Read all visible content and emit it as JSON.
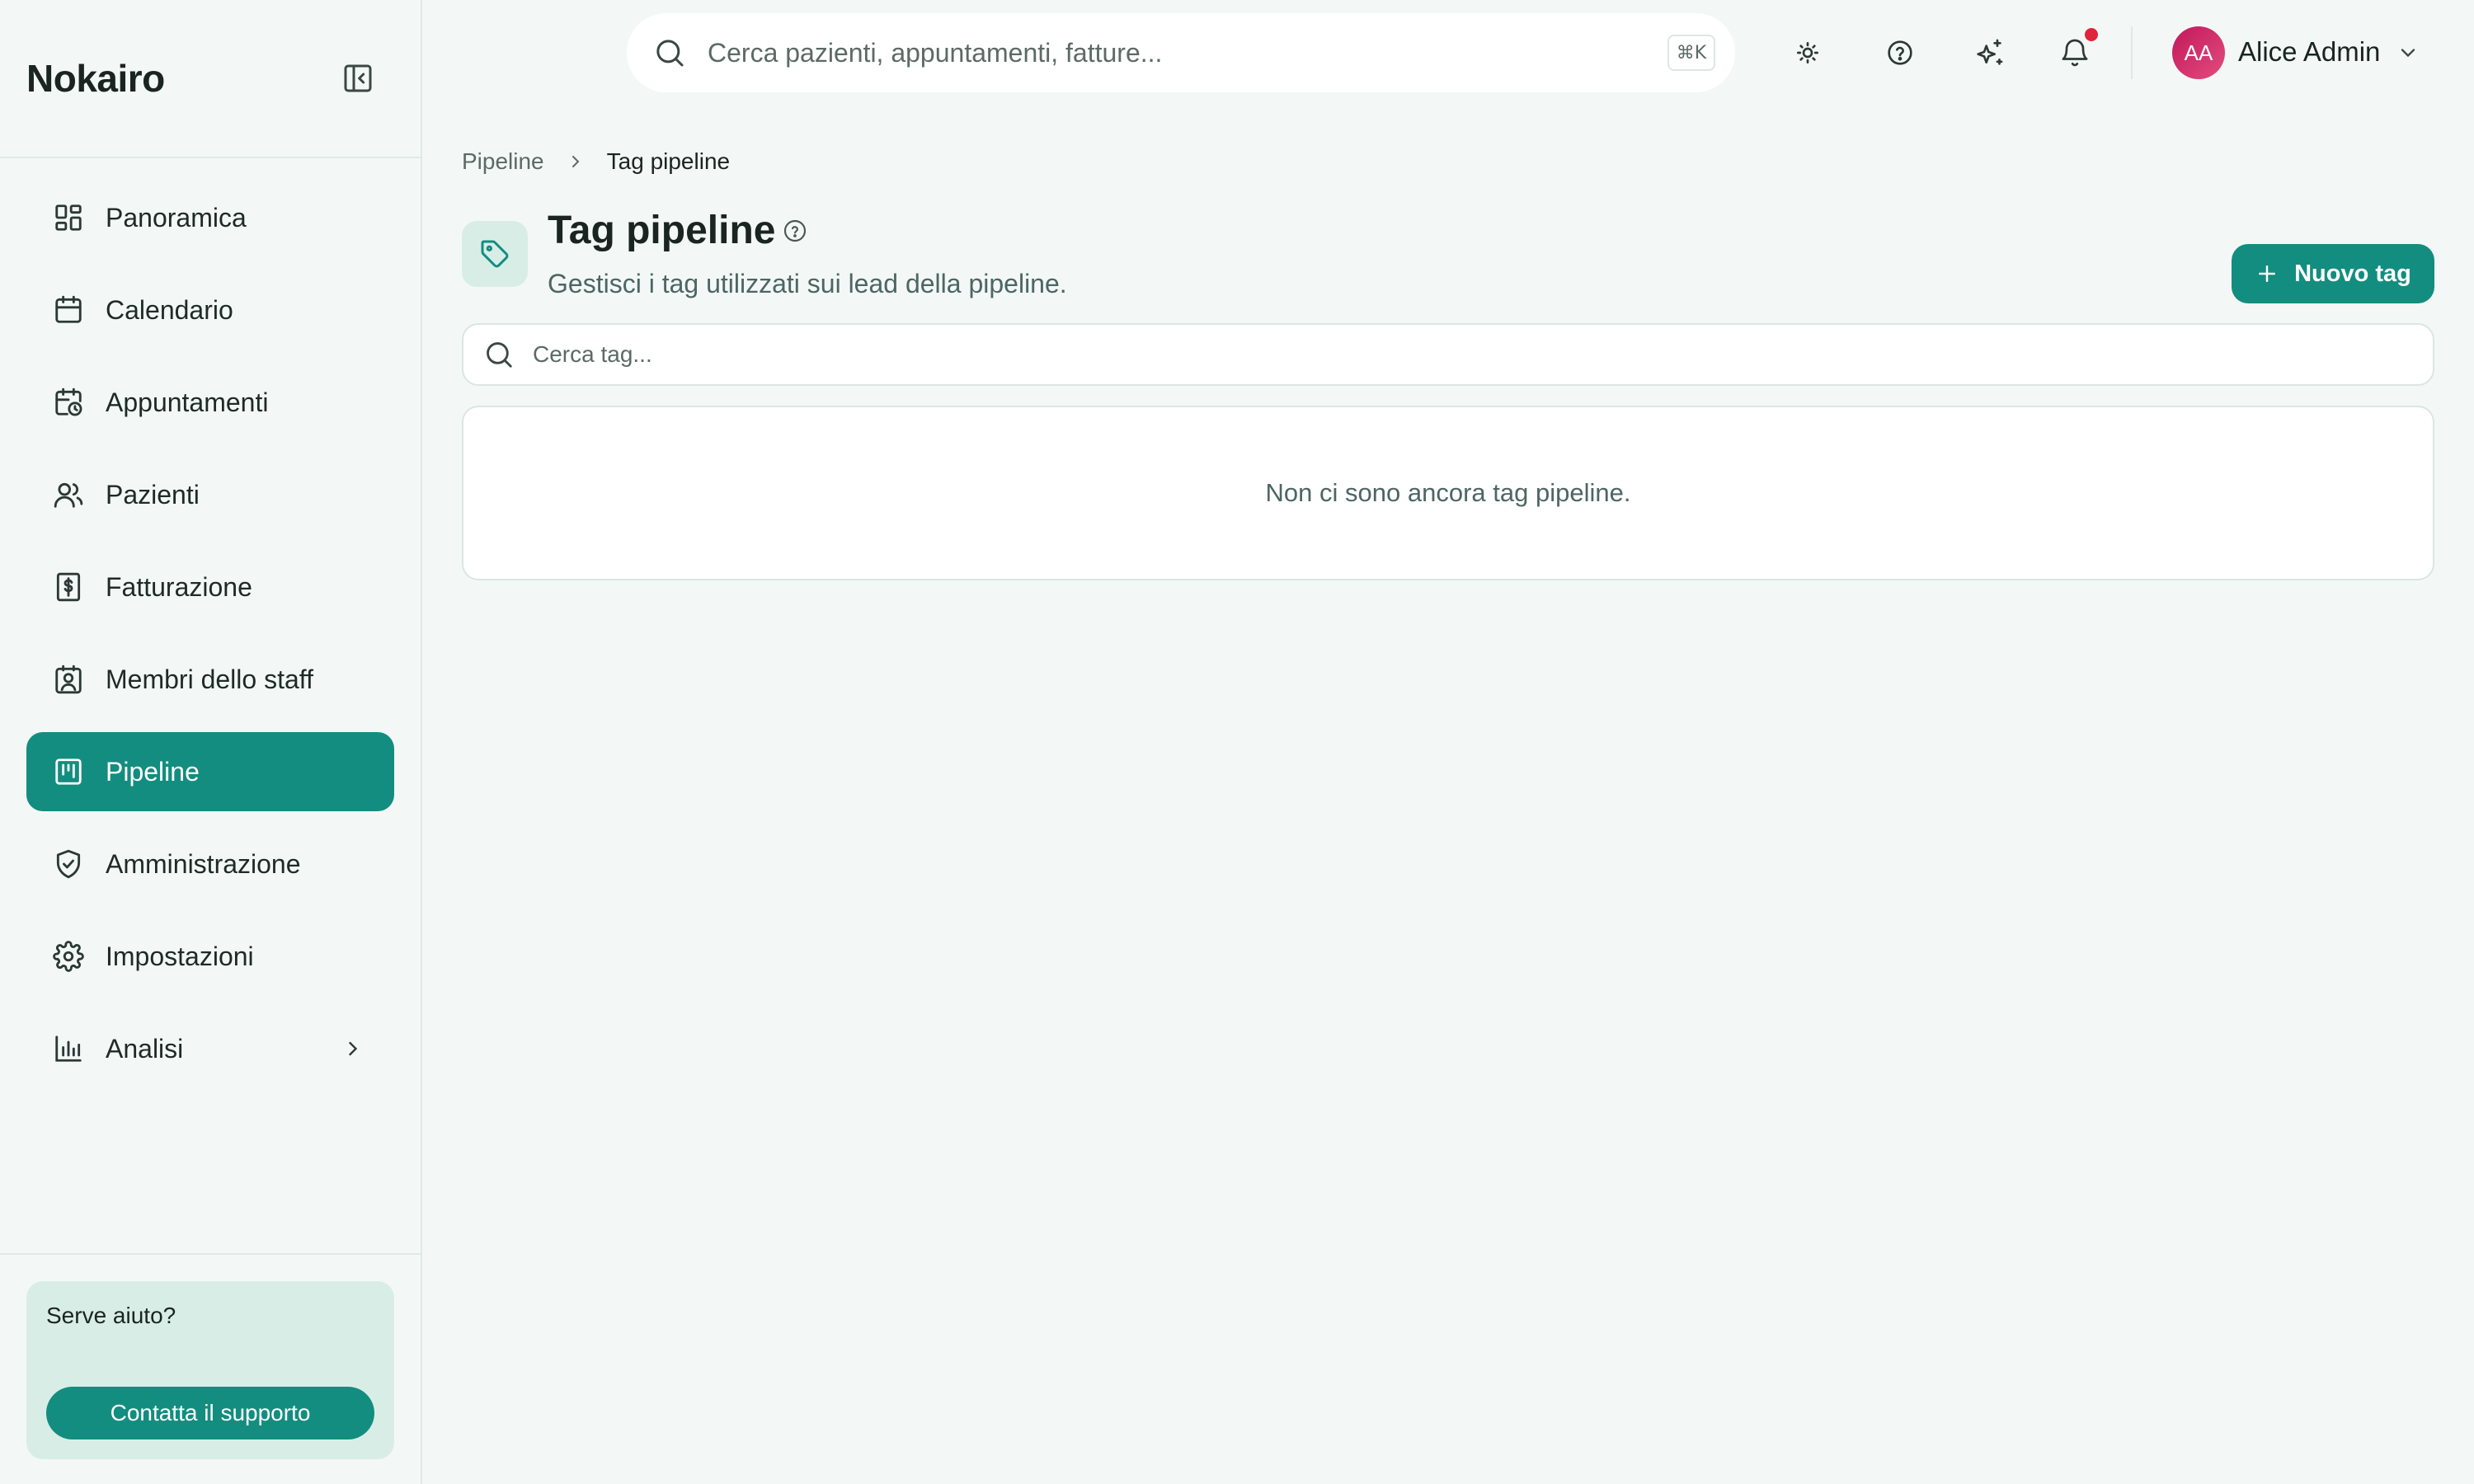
{
  "app": {
    "brand": "Nokairo"
  },
  "sidebar": {
    "items": [
      {
        "label": "Panoramica",
        "icon": "dashboard-grid-icon",
        "active": false
      },
      {
        "label": "Calendario",
        "icon": "calendar-icon",
        "active": false
      },
      {
        "label": "Appuntamenti",
        "icon": "calendar-clock-icon",
        "active": false
      },
      {
        "label": "Pazienti",
        "icon": "users-icon",
        "active": false
      },
      {
        "label": "Fatturazione",
        "icon": "receipt-dollar-icon",
        "active": false
      },
      {
        "label": "Membri dello staff",
        "icon": "contact-badge-icon",
        "active": false
      },
      {
        "label": "Pipeline",
        "icon": "kanban-board-icon",
        "active": true
      },
      {
        "label": "Amministrazione",
        "icon": "shield-check-icon",
        "active": false
      },
      {
        "label": "Impostazioni",
        "icon": "gear-icon",
        "active": false
      },
      {
        "label": "Analisi",
        "icon": "bar-chart-icon",
        "active": false,
        "expandable": true
      }
    ],
    "help": {
      "title": "Serve aiuto?",
      "button_label": "Contatta il supporto"
    }
  },
  "topbar": {
    "search_placeholder": "Cerca pazienti, appuntamenti, fatture...",
    "shortcut": "⌘K",
    "has_notifications": true,
    "user": {
      "initials": "AA",
      "name": "Alice Admin"
    }
  },
  "breadcrumb": {
    "parent": "Pipeline",
    "current": "Tag pipeline"
  },
  "page": {
    "title": "Tag pipeline",
    "subtitle": "Gestisci i tag utilizzati sui lead della pipeline.",
    "new_button_label": "Nuovo tag",
    "search_placeholder": "Cerca tag...",
    "empty_message": "Non ci sono ancora tag pipeline."
  },
  "colors": {
    "accent": "#138d7f",
    "accent_soft": "#d9ede7",
    "background": "#f3f8f6",
    "notification": "#e0243c",
    "avatar": "#d1326e"
  }
}
